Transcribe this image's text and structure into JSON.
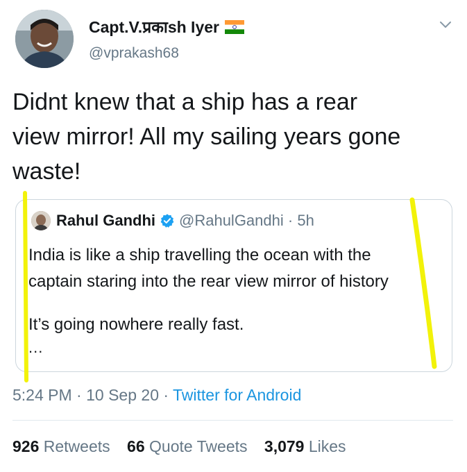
{
  "tweet": {
    "display_name": "Capt.V.प्रकाsh Iyer",
    "handle": "@vprakash68",
    "text_lines": [
      "Didnt knew that a ship has a rear",
      "view mirror! All my sailing years gone",
      "waste!"
    ],
    "timestamp": "5:24 PM",
    "date": "10 Sep 20",
    "source": "Twitter for Android"
  },
  "quoted_tweet": {
    "display_name": "Rahul Gandhi",
    "handle": "@RahulGandhi",
    "age": "5h",
    "lines": [
      "India is like a ship travelling the ocean with the",
      "captain staring into the rear view mirror of history",
      "It’s going nowhere really fast.",
      "..."
    ]
  },
  "stats": {
    "retweets_count": "926",
    "retweets_label": "Retweets",
    "quotes_count": "66",
    "quotes_label": "Quote Tweets",
    "likes_count": "3,079",
    "likes_label": "Likes"
  },
  "icons": {
    "flag": "india-flag-icon",
    "chevron": "chevron-down-icon",
    "verified": "verified-badge-icon"
  },
  "colors": {
    "link": "#1b95e0",
    "secondary_text": "#657786",
    "highlight": "#f2f20a",
    "flag_saffron": "#ff9933",
    "flag_green": "#138808"
  }
}
